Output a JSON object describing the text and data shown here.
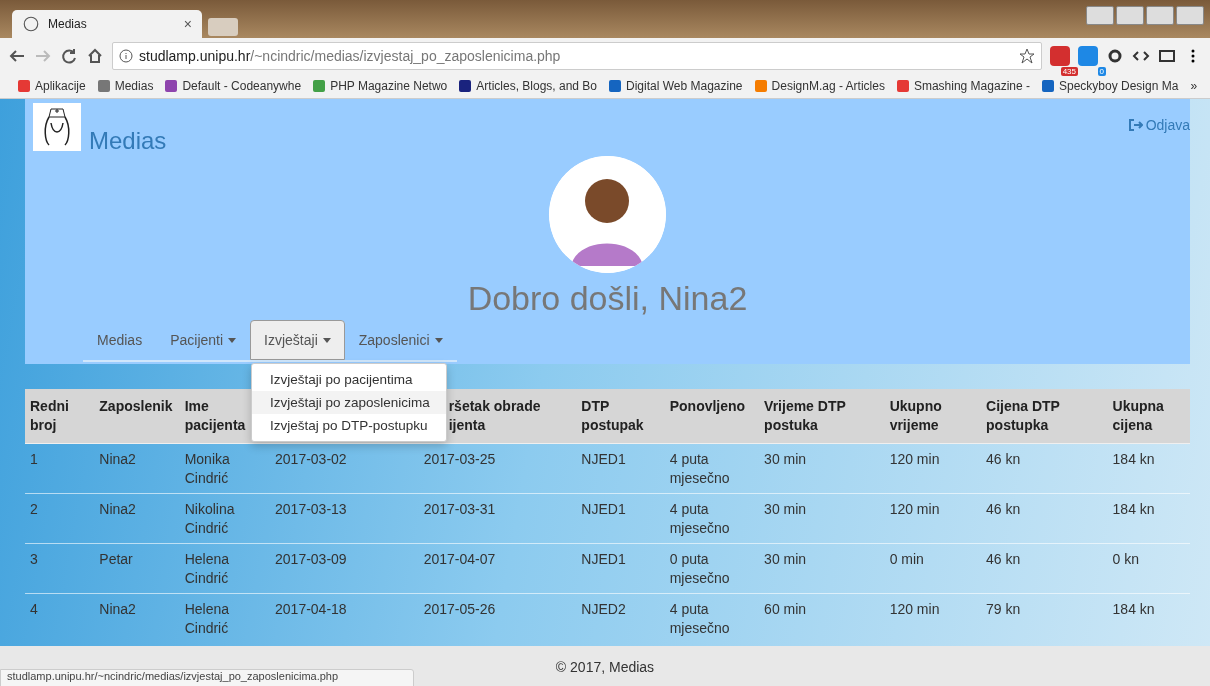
{
  "browser": {
    "tab": {
      "title": "Medias",
      "close": "×"
    },
    "url_host": "studlamp.unipu.hr",
    "url_path": "/~ncindric/medias/izvjestaj_po_zaposlenicima.php",
    "extensions": [
      {
        "badge": "435"
      },
      {
        "badge": "0"
      }
    ],
    "bookmarks": [
      {
        "label": "Aplikacije"
      },
      {
        "label": "Medias"
      },
      {
        "label": "Default - Codeanywhe"
      },
      {
        "label": "PHP Magazine Netwo"
      },
      {
        "label": "Articles, Blogs, and Bo"
      },
      {
        "label": "Digital Web Magazine"
      },
      {
        "label": "DesignM.ag - Articles"
      },
      {
        "label": "Smashing Magazine -"
      },
      {
        "label": "Speckyboy Design Ma"
      }
    ],
    "more": "»"
  },
  "header": {
    "brand": "Medias",
    "logout": "Odjava",
    "welcome": "Dobro došli, Nina2"
  },
  "nav": [
    {
      "label": "Medias",
      "dropdown": false,
      "selected": false
    },
    {
      "label": "Pacijenti",
      "dropdown": true,
      "selected": false
    },
    {
      "label": "Izvještaji",
      "dropdown": true,
      "selected": true
    },
    {
      "label": "Zaposlenici",
      "dropdown": true,
      "selected": false
    }
  ],
  "dropdown": {
    "items": [
      {
        "label": "Izvještaji po pacijentima",
        "selected": false
      },
      {
        "label": "Izvještaji po zaposlenicima",
        "selected": true
      },
      {
        "label": "Izvještaj po DTP-postupku",
        "selected": false
      }
    ]
  },
  "table": {
    "columns": [
      {
        "label": "Redni\nbroj"
      },
      {
        "label": "Zaposlenik"
      },
      {
        "label": "Ime\npacijenta"
      },
      {},
      {
        "label": "ršetak obrade\nijenta"
      },
      {
        "label": "DTP\npostupak"
      },
      {
        "label": "Ponovljeno"
      },
      {
        "label": "Vrijeme DTP\npostuka"
      },
      {
        "label": "Ukupno\nvrijeme"
      },
      {
        "label": "Cijena DTP\npostupka"
      },
      {
        "label": "Ukupna\ncijena"
      }
    ],
    "rows": [
      [
        "1",
        "Nina2",
        "Monika Cindrić",
        "2017-03-02",
        "2017-03-25",
        "NJED1",
        "4 puta mjesečno",
        "30 min",
        "120 min",
        "46 kn",
        "184 kn"
      ],
      [
        "2",
        "Nina2",
        "Nikolina Cindrić",
        "2017-03-13",
        "2017-03-31",
        "NJED1",
        "4 puta mjesečno",
        "30 min",
        "120 min",
        "46 kn",
        "184 kn"
      ],
      [
        "3",
        "Petar",
        "Helena Cindrić",
        "2017-03-09",
        "2017-04-07",
        "NJED1",
        "0 puta mjesečno",
        "30 min",
        "0 min",
        "46 kn",
        "0 kn"
      ],
      [
        "4",
        "Nina2",
        "Helena Cindrić",
        "2017-04-18",
        "2017-05-26",
        "NJED2",
        "4 puta mjesečno",
        "60 min",
        "120 min",
        "79 kn",
        "184 kn"
      ]
    ]
  },
  "footer": "© 2017, Medias",
  "status_bar": "studlamp.unipu.hr/~ncindric/medias/izvjestaj_po_zaposlenicima.php"
}
